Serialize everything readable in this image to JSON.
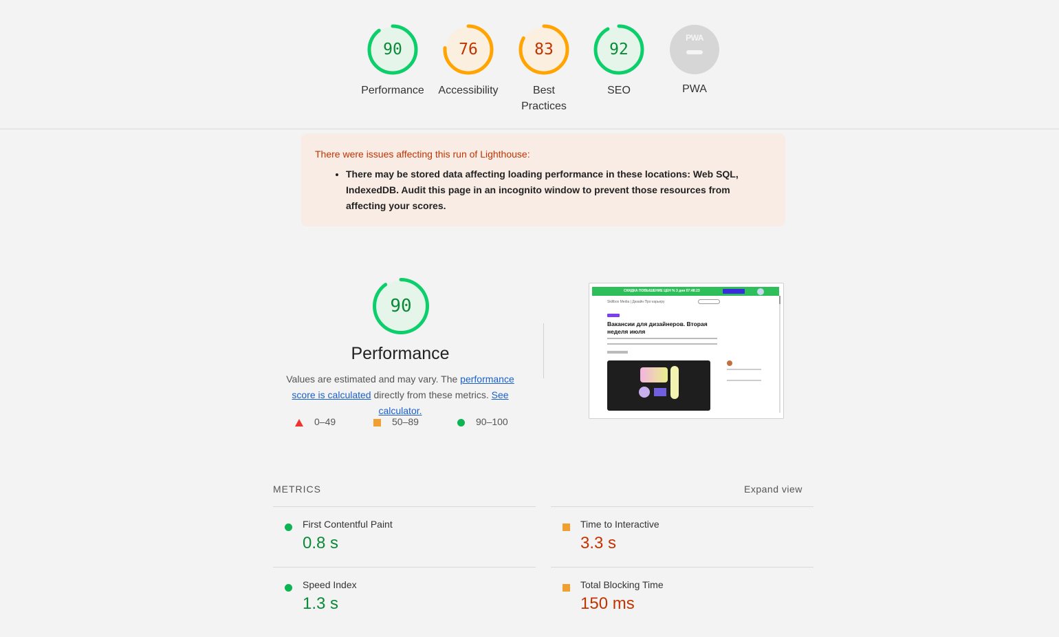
{
  "scores": [
    {
      "id": "performance",
      "value": "90",
      "label": "Performance",
      "score": 90,
      "color": "#0cce6b",
      "fill": "#e5f5ea",
      "text_color": "#0a8a38"
    },
    {
      "id": "accessibility",
      "value": "76",
      "label": "Accessibility",
      "score": 76,
      "color": "#ffa400",
      "fill": "#fbefe0",
      "text_color": "#c33300"
    },
    {
      "id": "best-practices",
      "value": "83",
      "label": "Best Practices",
      "score": 83,
      "color": "#ffa400",
      "fill": "#fbefe0",
      "text_color": "#c33300"
    },
    {
      "id": "seo",
      "value": "92",
      "label": "SEO",
      "score": 92,
      "color": "#0cce6b",
      "fill": "#e5f5ea",
      "text_color": "#0a8a38"
    }
  ],
  "pwa": {
    "label": "PWA",
    "badge_text": "PWA",
    "icon": "pwa-badge-icon"
  },
  "warning": {
    "title": "There were issues affecting this run of Lighthouse:",
    "items": [
      "There may be stored data affecting loading performance in these locations: Web SQL, IndexedDB. Audit this page in an incognito window to prevent those resources from affecting your scores."
    ]
  },
  "performance": {
    "score": "90",
    "score_value": 90,
    "title": "Performance",
    "desc_prefix": "Values are estimated and may vary. The ",
    "link_score": "performance score is calculated",
    "desc_middle": " directly from these metrics. ",
    "link_calc": "See calculator.",
    "legend": [
      {
        "icon": "red-triangle-icon",
        "range": "0–49"
      },
      {
        "icon": "orange-square-icon",
        "range": "50–89"
      },
      {
        "icon": "green-circle-icon",
        "range": "90–100"
      }
    ]
  },
  "thumbnail": {
    "banner": "СКИДКА ПОВЫШЕНИЕ ЦЕН   %  3 дня  07:48:23",
    "nav": "Skillbox Media  |  Дизайн          Про карьеру",
    "heading": "Вакансии для дизайнеров. Вторая неделя июля"
  },
  "metrics": {
    "heading": "METRICS",
    "expand": "Expand view",
    "items": [
      {
        "label": "First Contentful Paint",
        "value": "0.8 s",
        "status": "green"
      },
      {
        "label": "Time to Interactive",
        "value": "3.3 s",
        "status": "orange"
      },
      {
        "label": "Speed Index",
        "value": "1.3 s",
        "status": "green"
      },
      {
        "label": "Total Blocking Time",
        "value": "150 ms",
        "status": "orange"
      }
    ]
  }
}
